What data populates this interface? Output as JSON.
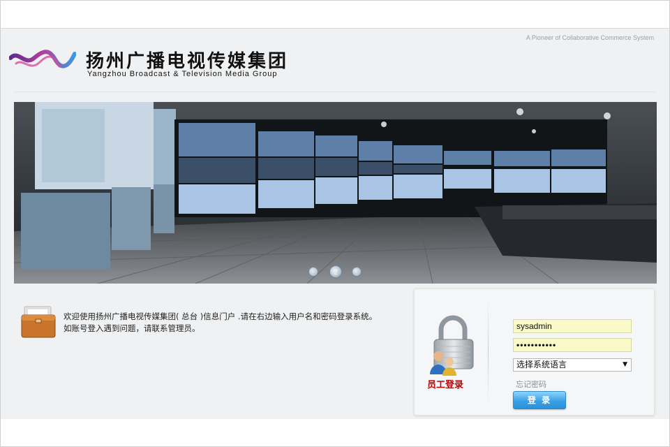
{
  "header": {
    "tagline": "A Pioneer of Collaborative Commerce System",
    "logo_cn": "扬州广播电视传媒集团",
    "logo_en": "Yangzhou Broadcast & Television Media Group"
  },
  "banner": {
    "pager": [
      "",
      "2",
      ""
    ],
    "active_slide": 2
  },
  "welcome": {
    "line1": "欢迎使用扬州广播电视传媒集团( 总台 )信息门户 .请在右边输入用户名和密码登录系统。",
    "line2": "如账号登入遇到问题，请联系管理员。"
  },
  "login": {
    "staff_title": "员工登录",
    "username": "sysadmin",
    "password_mask": "•••••••••••",
    "language_select": "选择系统语言",
    "forgot_link": "忘记密码",
    "submit_label": "登 录"
  },
  "colors": {
    "accent": "#3aa0e6",
    "staff_title": "#c00000",
    "input_fill": "#fafac8"
  }
}
